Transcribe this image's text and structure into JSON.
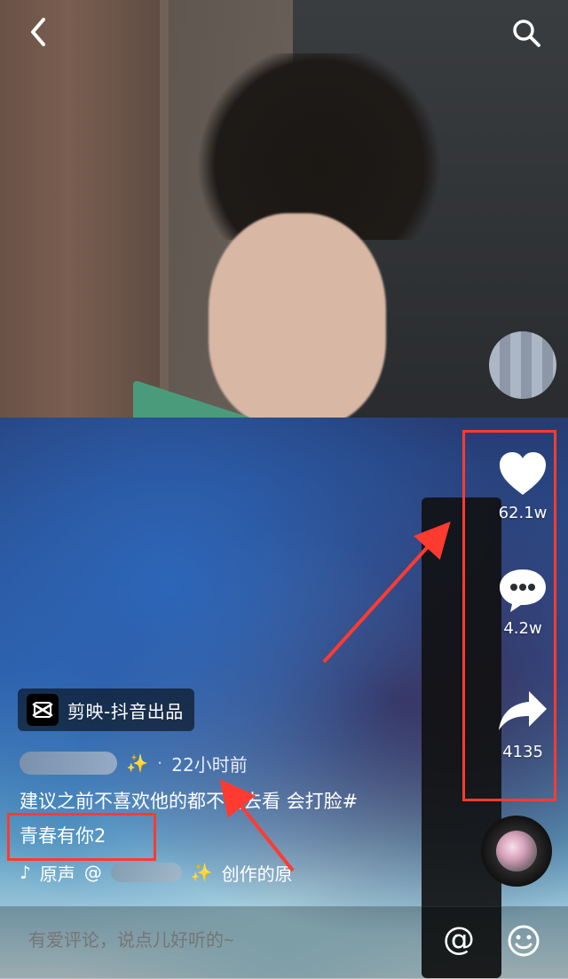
{
  "ui": {
    "icons": {
      "back": "back-chevron-icon",
      "search": "search-icon",
      "like": "heart-icon",
      "comment": "comment-bubble-icon",
      "share": "share-arrow-icon",
      "music": "tiktok-note-icon",
      "sparkle": "sparkle-icon",
      "emoji": "emoji-face-icon",
      "app_badge": "capcut-logo-icon"
    },
    "counts": {
      "likes": "62.1w",
      "comments": "4.2w",
      "shares": "4135"
    },
    "badge_label": "剪映-抖音出品",
    "author": {
      "time": "22小时前",
      "separator": "·"
    },
    "description": "建议之前不喜欢他的都不要去看 会打脸#",
    "hashtag": "青春有你2",
    "music": {
      "prefix": "原声",
      "text": "创作的原",
      "at": "@"
    },
    "comment": {
      "placeholder": "有爱评论，说点儿好听的~",
      "mention": "@"
    },
    "colors": {
      "annotation_red": "#ff3b30"
    }
  }
}
